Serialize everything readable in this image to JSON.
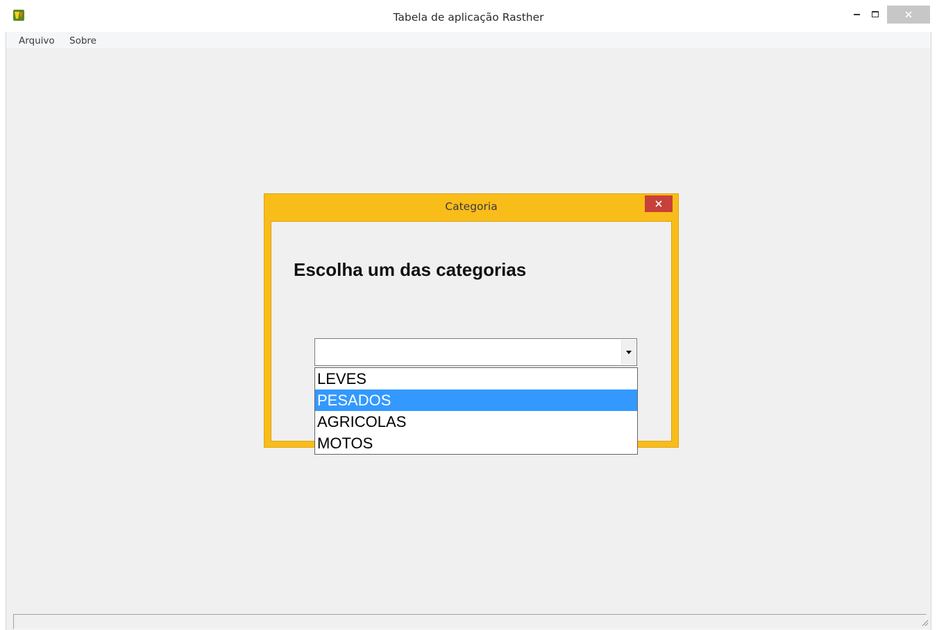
{
  "window": {
    "title": "Tabela de aplicação Rasther",
    "icon": "app-logo-icon",
    "controls": {
      "minimize": "minimize-icon",
      "maximize": "maximize-icon",
      "close": "close-icon"
    }
  },
  "menubar": {
    "items": [
      {
        "label": "Arquivo"
      },
      {
        "label": "Sobre"
      }
    ]
  },
  "dialog": {
    "title": "Categoria",
    "heading": "Escolha um das categorias",
    "accent_color": "#f9bd1a",
    "close_color": "#c8403a",
    "combo": {
      "value": "",
      "arrow_icon": "dropdown-arrow-icon",
      "options": [
        "LEVES",
        "PESADOS",
        "AGRICOLAS",
        "MOTOS"
      ],
      "highlighted": "PESADOS",
      "highlight_color": "#3399ff"
    }
  },
  "statusbar": {
    "text": ""
  }
}
